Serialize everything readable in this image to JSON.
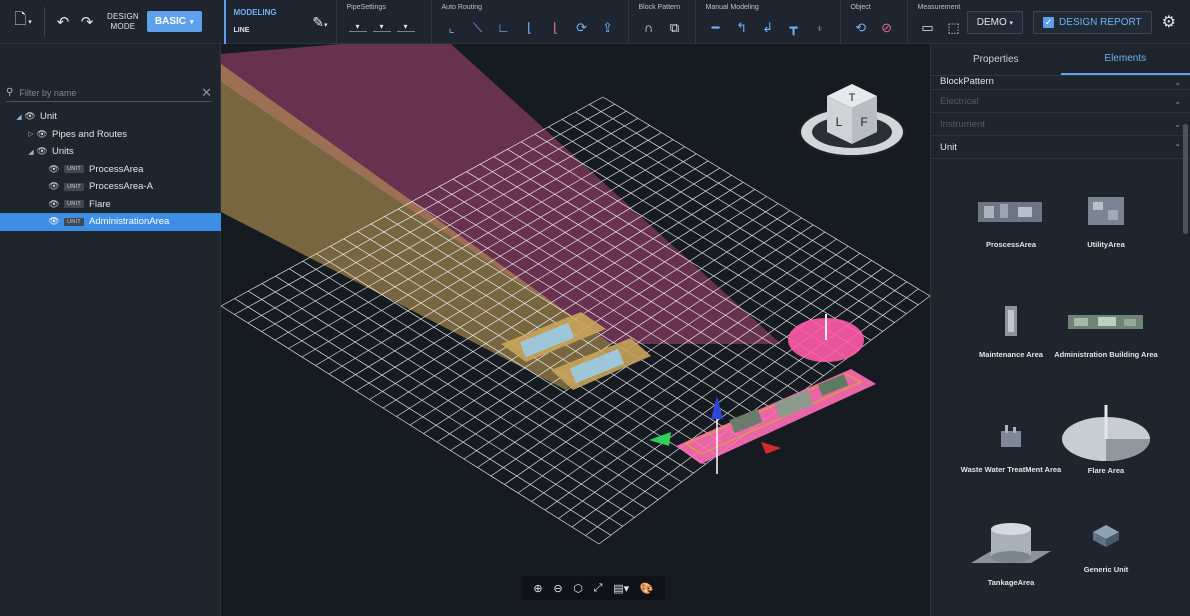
{
  "toolbar": {
    "design_mode": "DESIGN\nMODE",
    "basic": "BASIC",
    "modeling_label": "MODELING",
    "modeling_value": "LINE",
    "groups": [
      {
        "label": "PipeSettings"
      },
      {
        "label": "Auto Routing"
      },
      {
        "label": "Block Pattern"
      },
      {
        "label": "Manual Modeling"
      },
      {
        "label": "Object"
      },
      {
        "label": "Measurement"
      }
    ],
    "demo": "DEMO",
    "design_report": "DESIGN REPORT"
  },
  "tree": {
    "filter_placeholder": "Filter by name",
    "nodes": [
      {
        "label": "Unit"
      },
      {
        "label": "Pipes and Routes"
      },
      {
        "label": "Units"
      },
      {
        "label": "ProcessArea",
        "badge": "UNIT"
      },
      {
        "label": "ProcessArea-A",
        "badge": "UNIT"
      },
      {
        "label": "Flare",
        "badge": "UNIT"
      },
      {
        "label": "AdministrationArea",
        "badge": "UNIT"
      }
    ]
  },
  "panel": {
    "tabs": [
      "Properties",
      "Elements"
    ],
    "active_tab": "Elements",
    "sections": [
      "BlockPattern",
      "Electrical",
      "Instrument",
      "Unit"
    ],
    "elements": [
      {
        "label": "ProscessArea"
      },
      {
        "label": "UtilityArea"
      },
      {
        "label": "Maintenance Area"
      },
      {
        "label": "Administration Building Area"
      },
      {
        "label": "Waste Water TreatMent Area"
      },
      {
        "label": "Flare Area"
      },
      {
        "label": "TankageArea"
      },
      {
        "label": "Generic Unit"
      }
    ]
  },
  "viewcube": {
    "top": "T",
    "left": "L",
    "front": "F"
  },
  "colors": {
    "accent": "#5ea0ea",
    "selection": "#3d8ee4",
    "grid": "#ffffff",
    "beam_pink": "#c84f8a",
    "beam_gold": "#c9a45a"
  }
}
